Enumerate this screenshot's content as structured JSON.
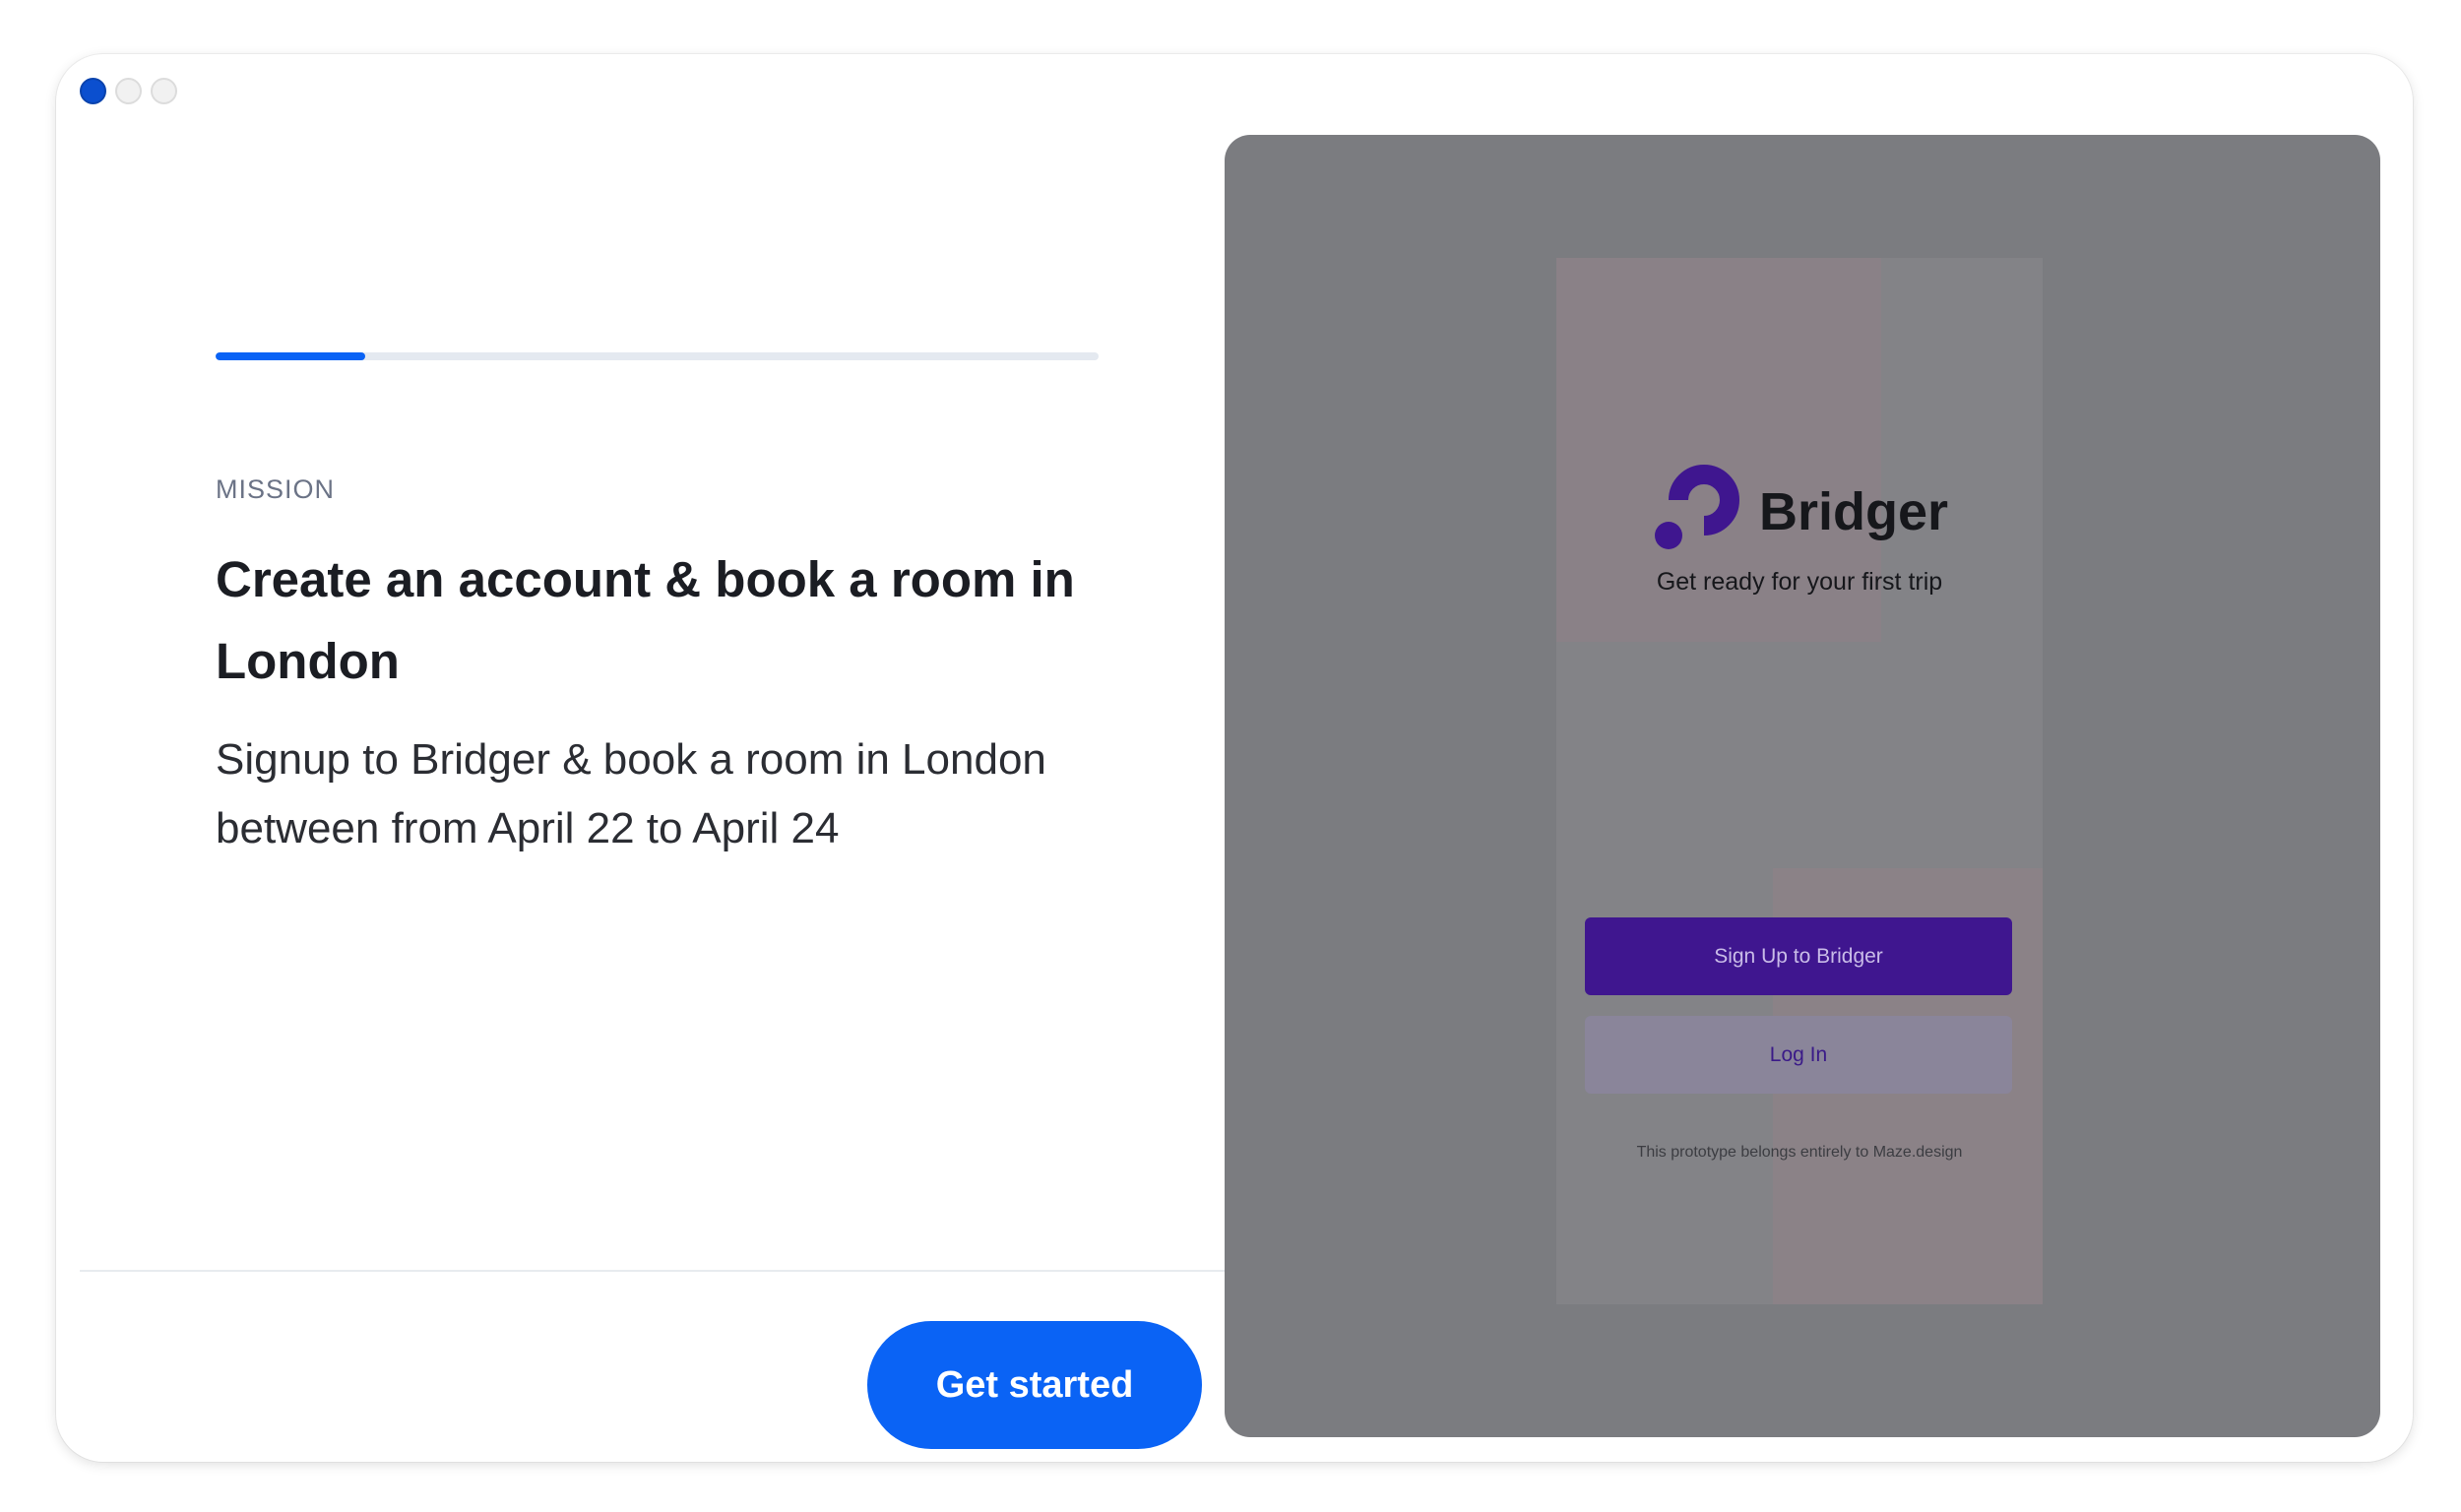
{
  "window": {
    "controls": [
      "active-dot",
      "inactive-dot",
      "inactive-dot"
    ]
  },
  "task": {
    "progress": 0.17,
    "eyebrow": "MISSION",
    "title": "Create an account & book a room in London",
    "description": "Signup to Bridger & book a room in London between from April 22 to April 24",
    "cta_label": "Get started"
  },
  "prototype": {
    "brand": "Bridger",
    "logo_icon": "bridger-logo-icon",
    "tagline": "Get ready for your first trip",
    "signup_label": "Sign Up to Bridger",
    "login_label": "Log In",
    "footnote": "This prototype belongs entirely to Maze.design"
  },
  "colors": {
    "accent": "#0a63f5",
    "brand_purple": "#3f168f",
    "overlay": "#7b7c80"
  }
}
